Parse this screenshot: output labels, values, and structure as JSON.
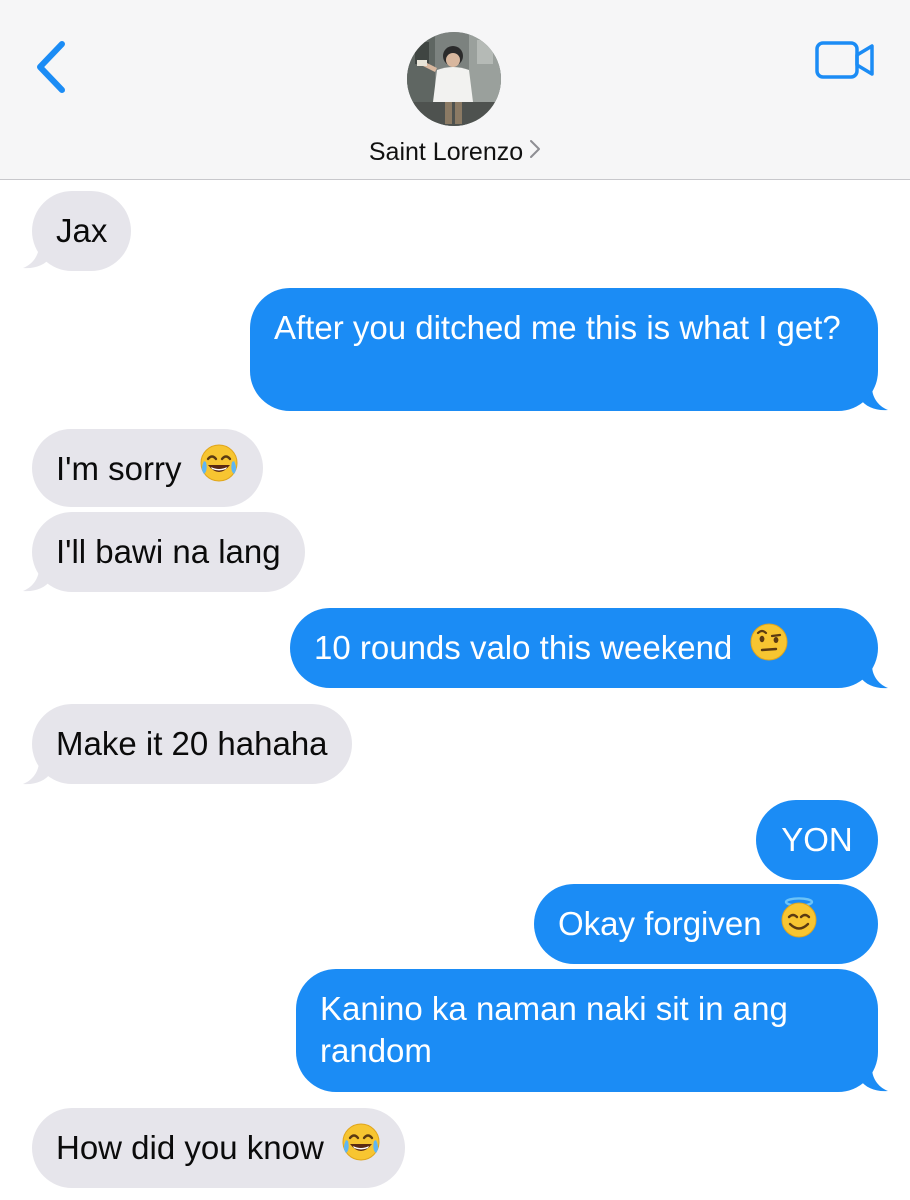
{
  "header": {
    "contact_name": "Saint Lorenzo",
    "back_icon": "chevron-left-icon",
    "video_icon": "video-camera-icon",
    "accent_color": "#1b8cf5"
  },
  "messages": [
    {
      "direction": "incoming",
      "text": "Jax"
    },
    {
      "direction": "outgoing",
      "text": "After you ditched me this is what I get?"
    },
    {
      "direction": "incoming",
      "text": "I'm sorry",
      "emoji": "face-with-tears-of-joy-icon"
    },
    {
      "direction": "incoming",
      "text": "I'll bawi na lang"
    },
    {
      "direction": "outgoing",
      "text": "10 rounds valo this weekend",
      "emoji": "face-with-raised-eyebrow-icon"
    },
    {
      "direction": "incoming",
      "text": "Make it 20 hahaha"
    },
    {
      "direction": "outgoing",
      "text": "YON"
    },
    {
      "direction": "outgoing",
      "text": "Okay forgiven",
      "emoji": "smiling-face-with-halo-icon"
    },
    {
      "direction": "outgoing",
      "text": "Kanino ka naman naki sit in ang random"
    },
    {
      "direction": "incoming",
      "text": "How did you know",
      "emoji": "face-with-tears-of-joy-icon"
    }
  ],
  "colors": {
    "incoming_bubble": "#e6e5eb",
    "outgoing_bubble": "#1b8cf5",
    "header_background": "#f6f6f7"
  }
}
